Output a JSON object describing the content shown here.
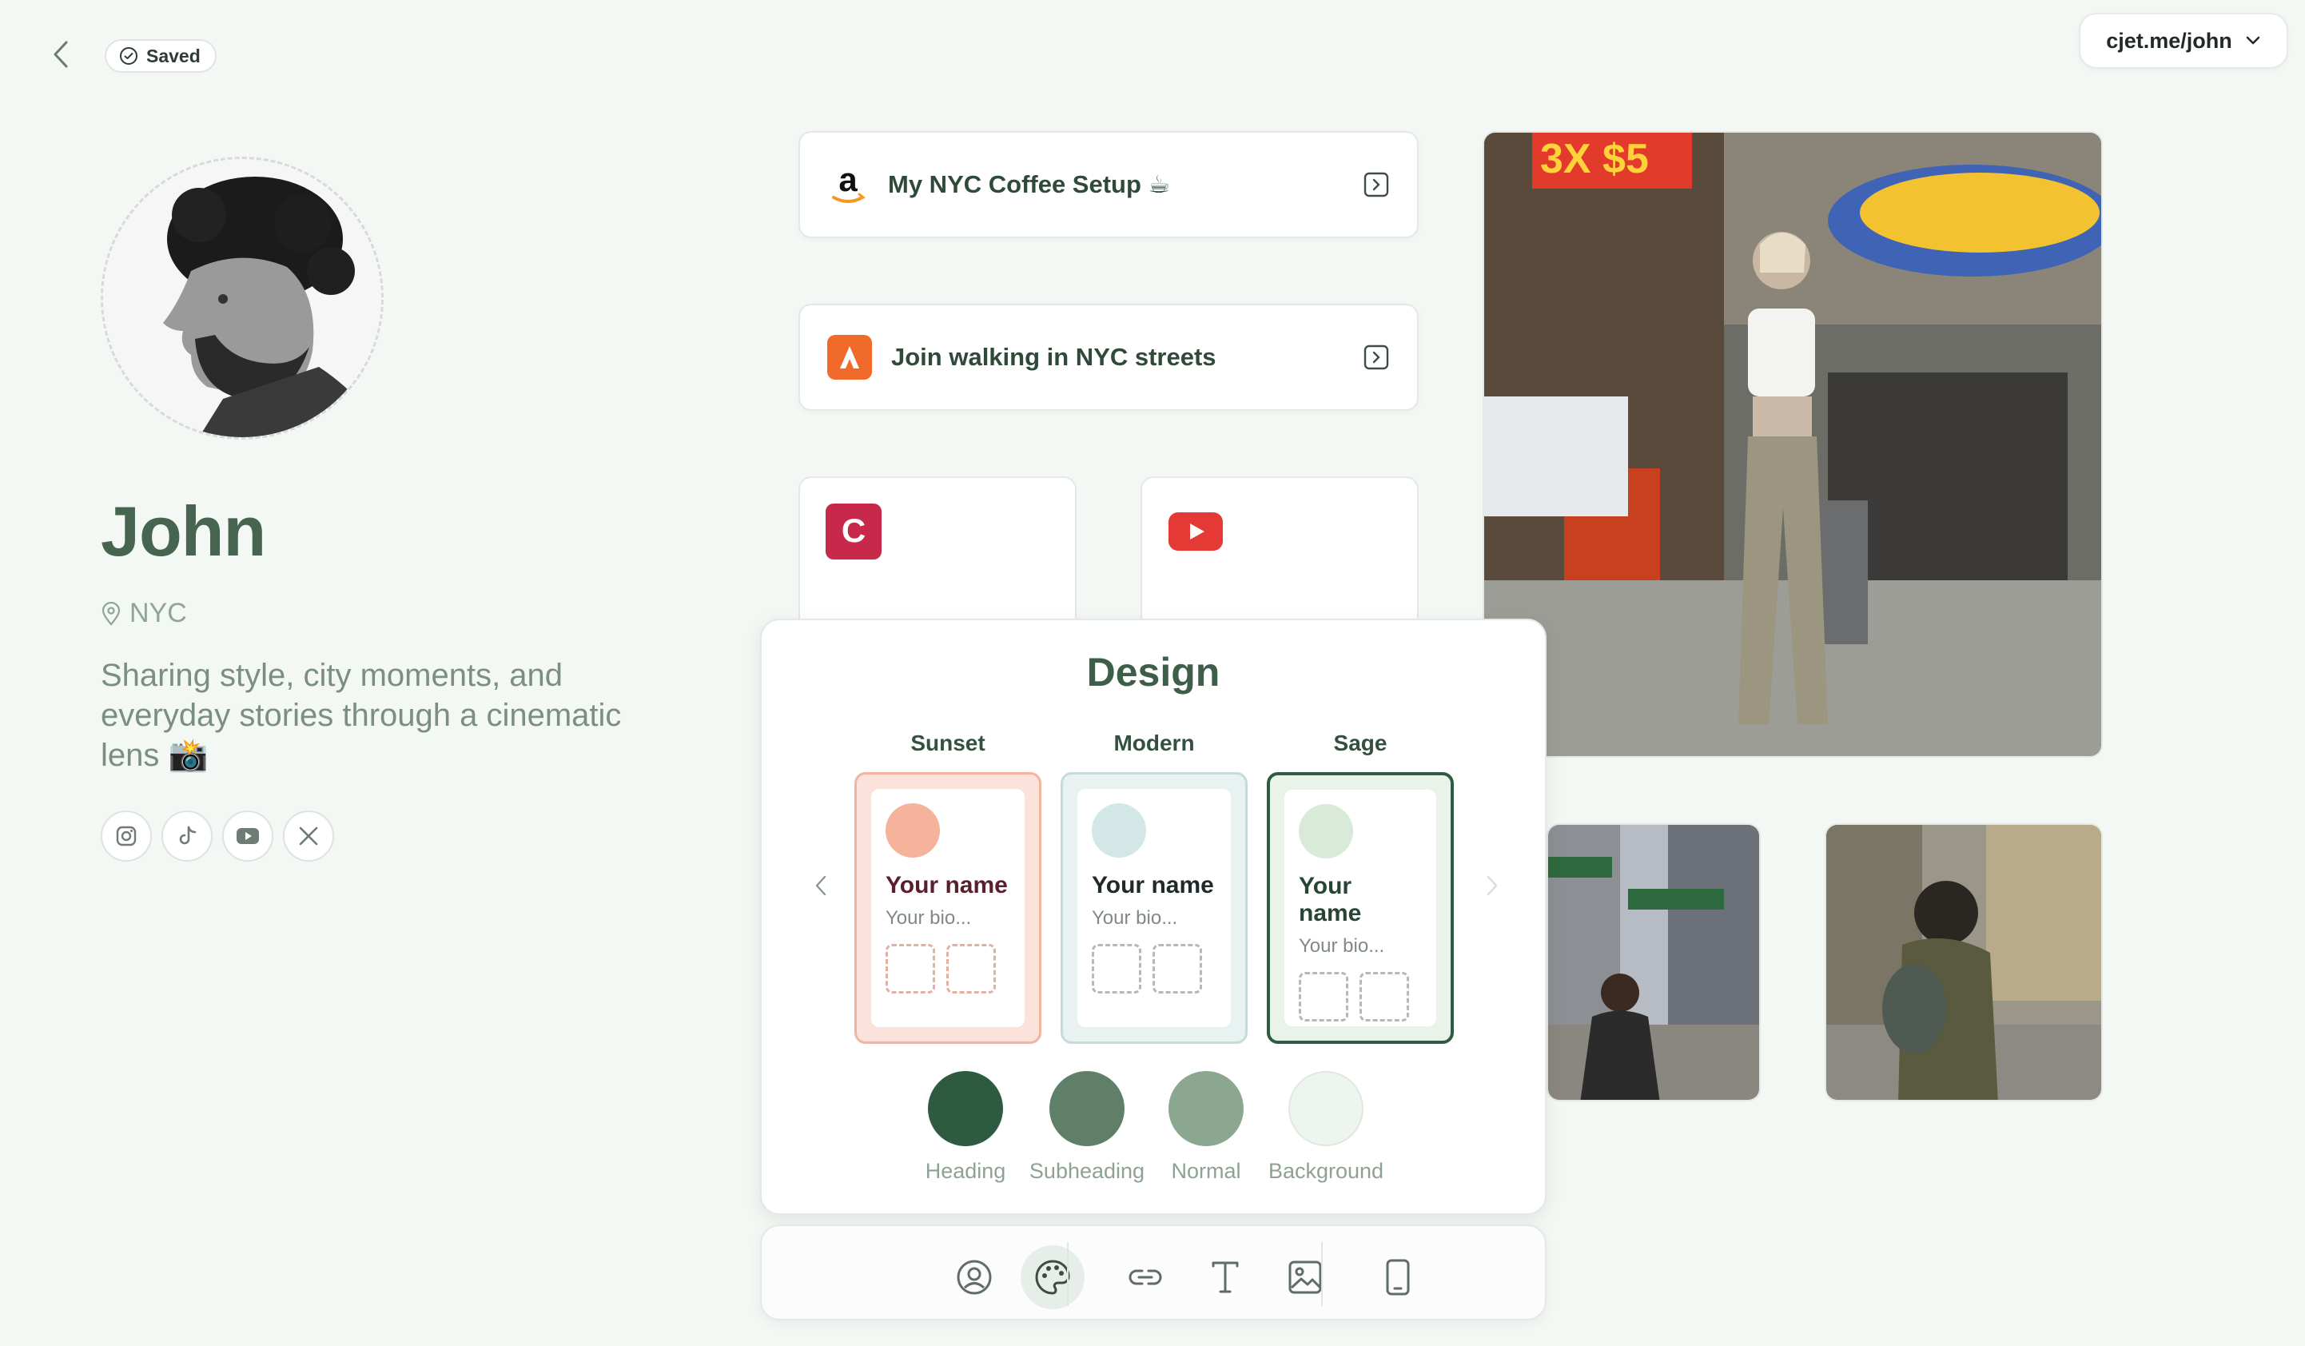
{
  "topbar": {
    "saved_label": "Saved",
    "url_label": "cjet.me/john"
  },
  "profile": {
    "name": "John",
    "location": "NYC",
    "bio": "Sharing style, city moments, and everyday stories through a cinematic lens 📸",
    "socials": [
      "instagram-icon",
      "tiktok-icon",
      "youtube-icon",
      "x-icon"
    ]
  },
  "links": [
    {
      "label": "My NYC Coffee Setup ☕",
      "icon": "amazon-icon"
    },
    {
      "label": "Join walking in NYC streets",
      "icon": "strava-icon"
    }
  ],
  "app_tiles": [
    "c-app-icon",
    "youtube-icon"
  ],
  "design": {
    "title": "Design",
    "themes": [
      {
        "label": "Sunset",
        "name": "Your name",
        "bio": "Your bio...",
        "accent": "#f5b39c",
        "border": "#f1b4a2",
        "bg": "#fbe3dc",
        "name_color": "#5a1f2e"
      },
      {
        "label": "Modern",
        "name": "Your name",
        "bio": "Your bio...",
        "accent": "#d3e8e6",
        "border": "#c4dbda",
        "bg": "#e7f2f1",
        "name_color": "#1f2b2a"
      },
      {
        "label": "Sage",
        "name": "Your name",
        "bio": "Your bio...",
        "accent": "#d9ead9",
        "border": "#2f5b42",
        "bg": "#eaf3ea",
        "name_color": "#264535"
      }
    ],
    "selected_theme": "Sage",
    "swatches": [
      {
        "label": "Heading",
        "color": "#2f5a42"
      },
      {
        "label": "Subheading",
        "color": "#5f7f68"
      },
      {
        "label": "Normal",
        "color": "#8ca78f"
      },
      {
        "label": "Background",
        "color": "#eef5ee"
      }
    ]
  },
  "toolbar": {
    "tools": [
      "profile-icon",
      "palette-icon",
      "link-icon",
      "text-icon",
      "image-icon",
      "phone-icon"
    ],
    "active_tool": "palette-icon"
  }
}
